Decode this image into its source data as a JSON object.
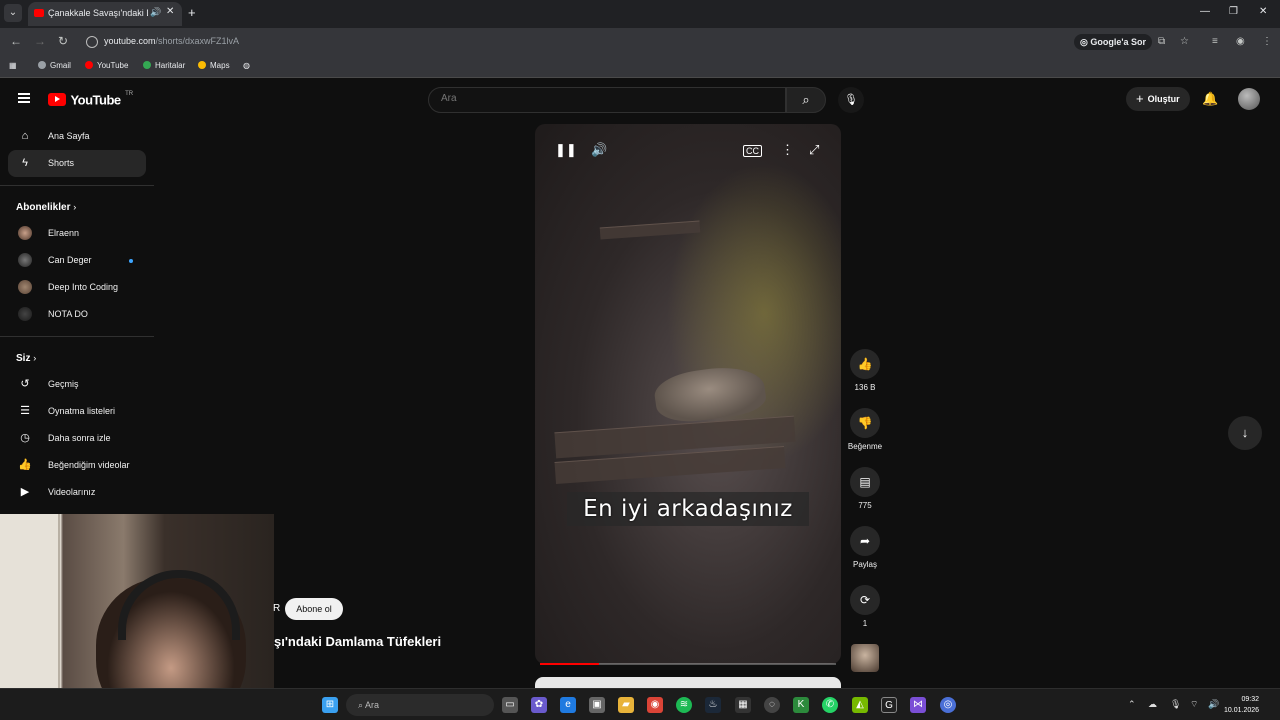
{
  "browser": {
    "tab_title": "Çanakkale Savaşı'ndaki Dam",
    "url_host": "youtube.com",
    "url_path": "/shorts/dxaxwFZ1lvA",
    "google_ask": "Google'a Sor",
    "bookmarks": [
      "Gmail",
      "YouTube",
      "Haritalar",
      "Maps"
    ]
  },
  "youtube": {
    "logo_text": "YouTube",
    "logo_country": "TR",
    "search_placeholder": "Ara",
    "create_label": "Oluştur"
  },
  "sidebar": {
    "items": [
      {
        "label": "Ana Sayfa",
        "icon": "home-icon"
      },
      {
        "label": "Shorts",
        "icon": "shorts-icon"
      }
    ],
    "subscriptions_header": "Abonelikler",
    "subscriptions": [
      {
        "label": "Elraenn"
      },
      {
        "label": "Can Deger"
      },
      {
        "label": "Deep Into Coding"
      },
      {
        "label": "NOTA DO"
      }
    ],
    "you_header": "Siz",
    "you_items": [
      {
        "label": "Geçmiş",
        "icon": "history-icon"
      },
      {
        "label": "Oynatma listeleri",
        "icon": "playlists-icon"
      },
      {
        "label": "Daha sonra izle",
        "icon": "watch-later-icon"
      },
      {
        "label": "Beğendiğim videolar",
        "icon": "liked-icon"
      },
      {
        "label": "Videolarınız",
        "icon": "your-videos-icon"
      }
    ]
  },
  "short": {
    "subtitle": "En iyi arkadaşınız",
    "progress": 0.2,
    "subscribe_label": "Abone ol",
    "channel_initial": "R",
    "title_fragment": "şı'ndaki Damlama Tüfekleri"
  },
  "actions": {
    "like_count": "136 B",
    "dislike_label": "Beğenme",
    "comment_count": "775",
    "share_label": "Paylaş",
    "remix_count": "1"
  },
  "taskbar": {
    "search_label": "Ara",
    "time": "09:32",
    "date": "10.01.2026"
  },
  "colors": {
    "brand": "#ff0000",
    "background": "#0f0f0f",
    "accent": "#3ea6ff"
  }
}
